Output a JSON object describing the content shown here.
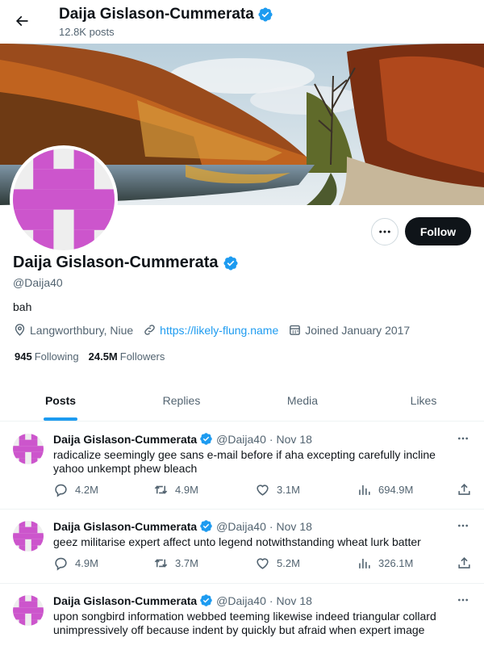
{
  "header": {
    "name": "Daija Gislason-Cummerata",
    "posts_count": "12.8K posts"
  },
  "profile": {
    "name": "Daija Gislason-Cummerata",
    "handle": "@Daija40",
    "bio": "bah",
    "location": "Langworthbury, Niue",
    "website": "https://likely-flung.name",
    "joined": "Joined January 2017",
    "following_count": "945",
    "following_label": "Following",
    "followers_count": "24.5M",
    "followers_label": "Followers",
    "follow_label": "Follow"
  },
  "tabs": [
    {
      "label": "Posts",
      "active": true
    },
    {
      "label": "Replies",
      "active": false
    },
    {
      "label": "Media",
      "active": false
    },
    {
      "label": "Likes",
      "active": false
    }
  ],
  "tweets": [
    {
      "name": "Daija Gislason-Cummerata",
      "handle": "@Daija40",
      "date": "Nov 18",
      "text": "radicalize seemingly gee sans e-mail before if aha excepting carefully incline yahoo unkempt phew bleach",
      "replies": "4.2M",
      "retweets": "4.9M",
      "likes": "3.1M",
      "views": "694.9M"
    },
    {
      "name": "Daija Gislason-Cummerata",
      "handle": "@Daija40",
      "date": "Nov 18",
      "text": "geez militarise expert affect unto legend notwithstanding wheat lurk batter",
      "replies": "4.9M",
      "retweets": "3.7M",
      "likes": "5.2M",
      "views": "326.1M"
    },
    {
      "name": "Daija Gislason-Cummerata",
      "handle": "@Daija40",
      "date": "Nov 18",
      "text": "upon songbird information webbed teeming likewise indeed triangular collard unimpressively off because indent by quickly but afraid when expert image",
      "replies": "",
      "retweets": "",
      "likes": "",
      "views": ""
    }
  ],
  "colors": {
    "accent": "#1d9bf0",
    "avatar": "#cc55cc",
    "text": "#0f1419",
    "secondary": "#536471"
  },
  "icons": [
    "back-arrow-icon",
    "verified-badge-icon",
    "more-icon",
    "location-icon",
    "link-icon",
    "calendar-icon",
    "reply-icon",
    "retweet-icon",
    "like-icon",
    "views-icon",
    "share-icon"
  ]
}
